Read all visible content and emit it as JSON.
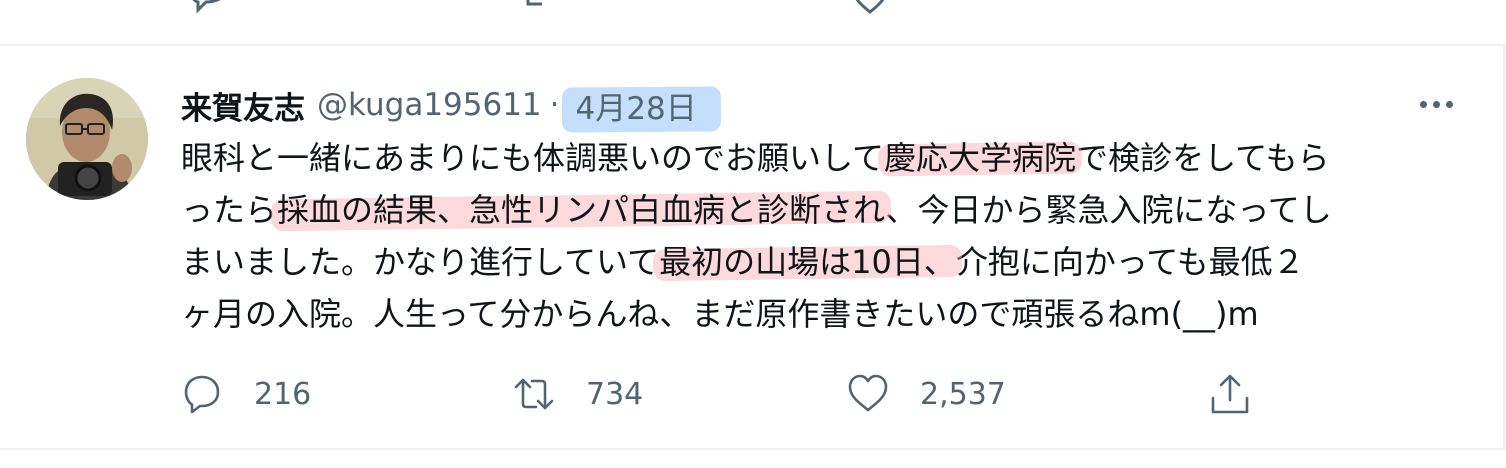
{
  "tweet": {
    "display_name": "来賀友志",
    "handle": "@kuga195611",
    "separator": "·",
    "date": "4月28日",
    "lines": [
      [
        {
          "text": "眼科と一緒にあまりにも体調悪いのでお願いして",
          "highlight": false
        },
        {
          "text": "慶応大学病院",
          "highlight": true
        },
        {
          "text": "で検診をしてもら",
          "highlight": false
        }
      ],
      [
        {
          "text": "ったら",
          "highlight": false
        },
        {
          "text": "採血の結果、急性リンパ白血病と診断され",
          "highlight": true
        },
        {
          "text": "、今日から緊急入院になってし",
          "highlight": false
        }
      ],
      [
        {
          "text": "まいました。かなり進行していて",
          "highlight": false
        },
        {
          "text": "最初の山場は10日、",
          "highlight": true
        },
        {
          "text": "介抱に向かっても最低２",
          "highlight": false
        }
      ],
      [
        {
          "text": "ヶ月の入院。人生って分からんね、まだ原作書きたいので頑張るねm(__)m",
          "highlight": false
        }
      ]
    ],
    "actions": {
      "reply_icon": "reply-icon",
      "reply_count": "216",
      "retweet_icon": "retweet-icon",
      "retweet_count": "734",
      "like_icon": "heart-icon",
      "like_count": "2,537",
      "share_icon": "share-icon"
    }
  },
  "colors": {
    "text_primary": "#0f1419",
    "text_secondary": "#536471",
    "divider": "#eff3f4",
    "highlight_pink": "#f8aab4",
    "highlight_blue": "#96c3f5"
  }
}
